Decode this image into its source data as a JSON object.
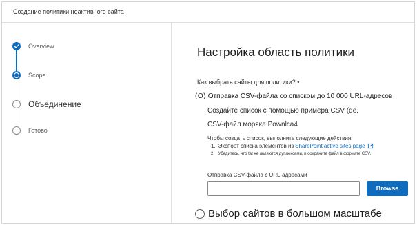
{
  "window": {
    "title": "Создание политики неактивного сайта"
  },
  "steps": [
    {
      "label": "Overview",
      "state": "done"
    },
    {
      "label": "Scope",
      "state": "current"
    },
    {
      "label": "Объединение",
      "state": "future"
    },
    {
      "label": "Готово",
      "state": "future"
    }
  ],
  "main": {
    "heading": "Настройка область политики",
    "question": "Как выбрать сайты для политики? •",
    "option_csv": {
      "radio_mark": "(O)",
      "label": "Отправка CSV-файла со списком до 10 000 URL-адресов",
      "create_text": "Создайте список с помощью примера CSV (de.",
      "sample_link_text": "CSV-файл моряка Pownlca4",
      "instructions_intro": "Чтобы создать список, выполните следующие действия:",
      "step1_number": "1.",
      "step1_text": "Экспорт списка элементов из",
      "step1_link": "SharePoint active sites page",
      "step2_number": "2.",
      "step2_text": "Убедитесь, что tat не являются дуплексами, и сохраните файл в формате CSV.",
      "upload_label": "Отправка CSV-файла с URL-адресами",
      "file_value": "",
      "browse_label": "Browse"
    },
    "option_bulk": {
      "label": "Выбор сайтов в большом масштабе"
    }
  },
  "colors": {
    "accent": "#0f6cbd",
    "border": "#e1dfdd",
    "text": "#252423"
  },
  "icons": [
    "checkmark-icon",
    "external-link-icon"
  ]
}
